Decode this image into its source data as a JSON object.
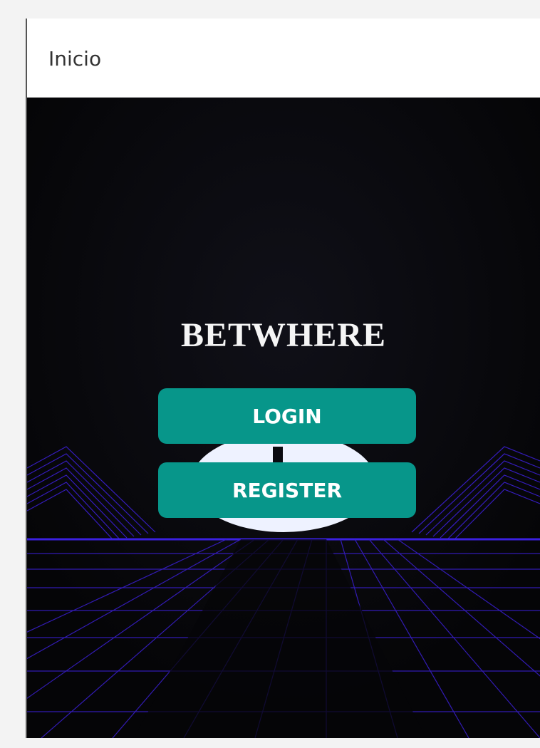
{
  "window": {
    "title": "Inicio"
  },
  "hero": {
    "brand": "BETWHERE",
    "login_label": "LOGIN",
    "register_label": "REGISTER"
  },
  "colors": {
    "background": "#060608",
    "accent": "#07968a",
    "grid": "#3a1fd1",
    "brand_text": "#f5f5f5"
  }
}
